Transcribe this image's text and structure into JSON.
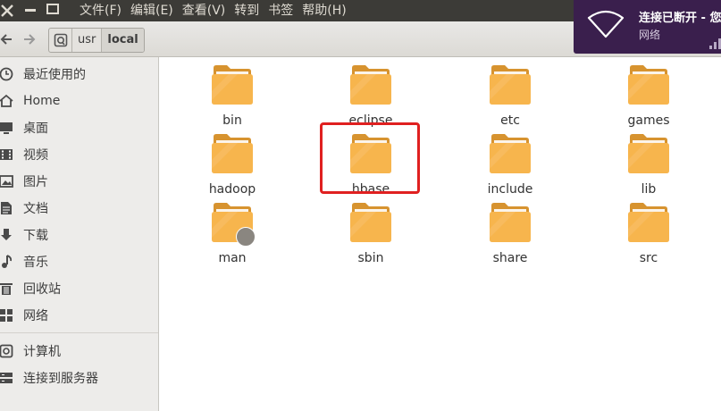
{
  "menubar": {
    "items": [
      "文件(F)",
      "编辑(E)",
      "查看(V)",
      "转到",
      "书签",
      "帮助(H)"
    ]
  },
  "toolbar": {
    "back_icon": "arrow-left-icon",
    "forward_icon": "arrow-right-icon",
    "crumbs": [
      "usr",
      "local"
    ]
  },
  "notification": {
    "title": "连接已断开 - 您",
    "body": "网络",
    "icon": "wifi-icon"
  },
  "sidebar": {
    "items": [
      {
        "label": "最近使用的",
        "icon": "clock-icon"
      },
      {
        "label": "Home",
        "icon": "home-icon"
      },
      {
        "label": "桌面",
        "icon": "desktop-icon"
      },
      {
        "label": "视频",
        "icon": "film-icon"
      },
      {
        "label": "图片",
        "icon": "image-icon"
      },
      {
        "label": "文档",
        "icon": "document-icon"
      },
      {
        "label": "下载",
        "icon": "download-icon"
      },
      {
        "label": "音乐",
        "icon": "music-icon"
      },
      {
        "label": "回收站",
        "icon": "trash-icon"
      },
      {
        "label": "网络",
        "icon": "network-icon"
      }
    ],
    "devices": [
      {
        "label": "计算机",
        "icon": "computer-icon"
      },
      {
        "label": "连接到服务器",
        "icon": "server-icon"
      }
    ]
  },
  "folders": [
    {
      "name": "bin"
    },
    {
      "name": "eclipse"
    },
    {
      "name": "etc"
    },
    {
      "name": "games"
    },
    {
      "name": "hadoop"
    },
    {
      "name": "hbase"
    },
    {
      "name": "include"
    },
    {
      "name": "lib"
    },
    {
      "name": "man",
      "symlink": true
    },
    {
      "name": "sbin"
    },
    {
      "name": "share"
    },
    {
      "name": "src"
    }
  ],
  "colors": {
    "menubar_bg": "#3c3b37",
    "notification_bg": "#3a1f4d",
    "folder": "#f7b54d",
    "highlight": "#e02020"
  }
}
